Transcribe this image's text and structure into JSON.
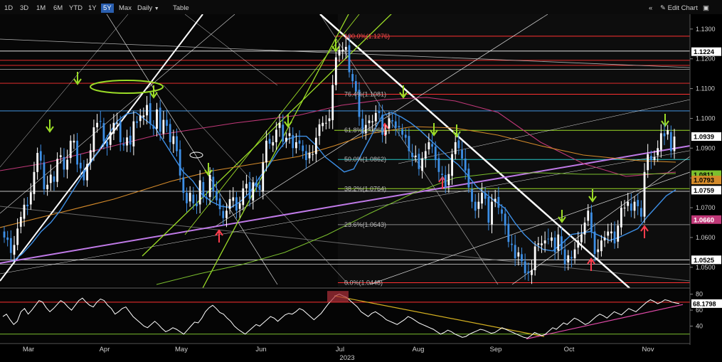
{
  "toolbar": {
    "ranges": [
      "1D",
      "3D",
      "1M",
      "6M",
      "YTD",
      "1Y",
      "5Y",
      "Max"
    ],
    "active_range": "5Y",
    "interval": "Daily",
    "interval_arrow": "▼",
    "table_label": "Table",
    "collapse_icon": "«",
    "edit_label": "Edit Chart",
    "edit_icon": "✎",
    "window_icon": "▣"
  },
  "colors": {
    "up": "#ffffff",
    "down": "#3d8fe6",
    "fib": "#ff3030",
    "ma_fast": "#3d8fe6",
    "ma_mid": "#c03878",
    "ma_slow": "#d48a2a",
    "ma_long": "#7bbf2e",
    "violet_trend": "#c07ae8",
    "green_lines": "#9bdc27",
    "arrow_green": "#9bdc27",
    "arrow_red": "#ff3d4d"
  },
  "chart_data": {
    "type": "candlestick",
    "ylim": [
      1.0435,
      1.1345
    ],
    "y_ticks": [
      "1.1300",
      "1.1200",
      "1.1100",
      "1.1000",
      "1.0900",
      "1.0800",
      "1.0700",
      "1.0600",
      "1.0500"
    ],
    "x_months": [
      "Mar",
      "Apr",
      "May",
      "Jun",
      "Jul",
      "Aug",
      "Sep",
      "Oct",
      "Nov"
    ],
    "x_year": "2023",
    "price_tags": [
      {
        "label": "1.1224",
        "value": 1.1224,
        "bg": "#ffffff",
        "fg": "#000000"
      },
      {
        "label": "1.0939",
        "value": 1.0939,
        "bg": "#ffffff",
        "fg": "#000000"
      },
      {
        "label": "1.0811",
        "value": 1.0811,
        "bg": "#7bbf2e",
        "fg": "#000000"
      },
      {
        "label": "1.0793",
        "value": 1.0793,
        "bg": "#d48a2a",
        "fg": "#000000"
      },
      {
        "label": "1.0759",
        "value": 1.0759,
        "bg": "#ffffff",
        "fg": "#000000"
      },
      {
        "label": "1.0660",
        "value": 1.066,
        "bg": "#c03878",
        "fg": "#ffffff"
      },
      {
        "label": "1.0525",
        "value": 1.0525,
        "bg": "#ffffff",
        "fg": "#000000"
      }
    ],
    "fib_levels": [
      {
        "label": "100.0%(1.1276)",
        "value": 1.1276
      },
      {
        "label": "76.4%(1.1081)",
        "value": 1.1081
      },
      {
        "label": "61.8%(1.0960)",
        "value": 1.096
      },
      {
        "label": "50.0%(1.0862)",
        "value": 1.0862
      },
      {
        "label": "38.2%(1.0764)",
        "value": 1.0764
      },
      {
        "label": "23.6%(1.0643)",
        "value": 1.0643
      },
      {
        "label": "0.0%(1.0448)",
        "value": 1.0448
      }
    ],
    "candles_close": [
      1.06,
      1.0592,
      1.0548,
      1.0575,
      1.063,
      1.0669,
      1.071,
      1.0705,
      1.0752,
      1.082,
      1.0884,
      1.0858,
      1.0762,
      1.0777,
      1.0811,
      1.0787,
      1.0864,
      1.0876,
      1.0828,
      1.0861,
      1.0925,
      1.0925,
      1.0845,
      1.0832,
      1.0792,
      1.0847,
      1.0893,
      1.097,
      1.0985,
      1.099,
      1.0922,
      1.0905,
      1.0955,
      1.0985,
      1.0985,
      1.092,
      1.0909,
      1.0936,
      1.0912,
      1.099,
      1.0985,
      1.101,
      1.101,
      1.1045,
      1.0982,
      1.0965,
      1.103,
      1.0955,
      1.0995,
      1.0975,
      1.092,
      1.094,
      1.089,
      1.0808,
      1.075,
      1.0715,
      1.075,
      1.0715,
      1.0705,
      1.0792,
      1.0735,
      1.073,
      1.081,
      1.0755,
      1.0725,
      1.0695,
      1.0665,
      1.069,
      1.0729,
      1.0735,
      1.069,
      1.0715,
      1.0765,
      1.078,
      1.073,
      1.0785,
      1.077,
      1.076,
      1.0852,
      1.0925,
      1.0915,
      1.092,
      1.0962,
      1.0985,
      1.0922,
      1.0935,
      1.095,
      1.09,
      1.092,
      1.0915,
      1.089,
      1.086,
      1.0885,
      1.088,
      1.0935,
      1.098,
      1.0985,
      1.0985,
      1.1,
      1.1112,
      1.1205,
      1.123,
      1.123,
      1.124,
      1.1155,
      1.1125,
      1.109,
      1.1005,
      1.095,
      1.0978,
      1.0993,
      1.099,
      1.1018,
      1.1018,
      1.0945,
      1.096,
      1.1,
      1.099,
      1.0968,
      1.097,
      1.0945,
      1.0935,
      1.089,
      1.087,
      1.0875,
      1.083,
      1.0865,
      1.089,
      1.092,
      1.0905,
      1.086,
      1.082,
      1.081,
      1.077,
      1.0813,
      1.088,
      1.092,
      1.09,
      1.0865,
      1.0825,
      1.0768,
      1.072,
      1.069,
      1.072,
      1.075,
      1.073,
      1.065,
      1.072,
      1.073,
      1.07,
      1.068,
      1.064,
      1.0585,
      1.0575,
      1.053,
      1.055,
      1.052,
      1.048,
      1.048,
      1.049,
      1.057,
      1.058,
      1.058,
      1.059,
      1.0595,
      1.06,
      1.055,
      1.061,
      1.056,
      1.051,
      1.054,
      1.053,
      1.056,
      1.059,
      1.061,
      1.065,
      1.069,
      1.062,
      1.0545,
      1.056,
      1.059,
      1.06,
      1.062,
      1.062,
      1.058,
      1.064,
      1.07,
      1.07,
      1.072,
      1.069,
      1.072,
      1.0705,
      1.067,
      1.082,
      1.088,
      1.086,
      1.087,
      1.09,
      1.095,
      1.094,
      1.096,
      1.089,
      1.0939
    ],
    "fast_ma": [
      1.052,
      1.0545,
      1.058,
      1.062,
      1.065,
      1.069,
      1.074,
      1.079,
      1.084,
      1.0888,
      1.094,
      1.099,
      1.1015,
      1.102,
      1.0995,
      1.097,
      1.092,
      1.087,
      1.082,
      1.079,
      1.0744,
      1.072,
      1.0705,
      1.07,
      1.072,
      1.075,
      1.08,
      1.084,
      1.089,
      1.093,
      1.094,
      1.094,
      1.091,
      1.087,
      1.0845,
      1.082,
      1.083,
      1.089,
      1.095,
      1.1009,
      1.102,
      1.1005,
      1.0985,
      1.096,
      1.093,
      1.09,
      1.087,
      1.0845,
      1.081,
      1.077,
      1.0745,
      1.072,
      1.0697,
      1.065,
      1.061,
      1.058,
      1.056,
      1.0555,
      1.058,
      1.061,
      1.0615,
      1.062,
      1.0605,
      1.059,
      1.06,
      1.0615,
      1.063,
      1.067,
      1.0705,
      1.074,
      1.076
    ],
    "osc_ticks": [
      "80",
      "60",
      "40"
    ],
    "osc_ylim": [
      20,
      85
    ],
    "osc_last": "68.1798",
    "osc": [
      52,
      55,
      48,
      42,
      46,
      58,
      62,
      55,
      60,
      66,
      72,
      70,
      63,
      58,
      62,
      67,
      72,
      69,
      64,
      60,
      66,
      72,
      75,
      70,
      66,
      64,
      70,
      74,
      72,
      66,
      62,
      55,
      58,
      62,
      64,
      58,
      52,
      48,
      44,
      40,
      38,
      42,
      46,
      42,
      37,
      33,
      35,
      38,
      36,
      33,
      30,
      35,
      40,
      45,
      44,
      50,
      58,
      63,
      66,
      62,
      57,
      55,
      50,
      46,
      40,
      36,
      33,
      30,
      34,
      38,
      42,
      40,
      44,
      48,
      52,
      50,
      46,
      50,
      54,
      56,
      55,
      58,
      62,
      60,
      56,
      52,
      48,
      52,
      56,
      62,
      68,
      73,
      78,
      80,
      78,
      76,
      72,
      68,
      64,
      58,
      55,
      52,
      56,
      58,
      55,
      52,
      48,
      46,
      44,
      42,
      45,
      48,
      52,
      50,
      47,
      44,
      42,
      40,
      38,
      36,
      33,
      30,
      32,
      35,
      33,
      30,
      28,
      26,
      27,
      30,
      32,
      34,
      36,
      35,
      33,
      31,
      32,
      35,
      38,
      36,
      34,
      32,
      30,
      28,
      26,
      25,
      28,
      32,
      30,
      28,
      30,
      34,
      38,
      36,
      40,
      44,
      42,
      46,
      50,
      48,
      45,
      42,
      44,
      48,
      52,
      55,
      53,
      50,
      54,
      58,
      56,
      54,
      58,
      62,
      60,
      58,
      62,
      66,
      70,
      73,
      71,
      68,
      70,
      73,
      72,
      70,
      69,
      68.18
    ]
  }
}
